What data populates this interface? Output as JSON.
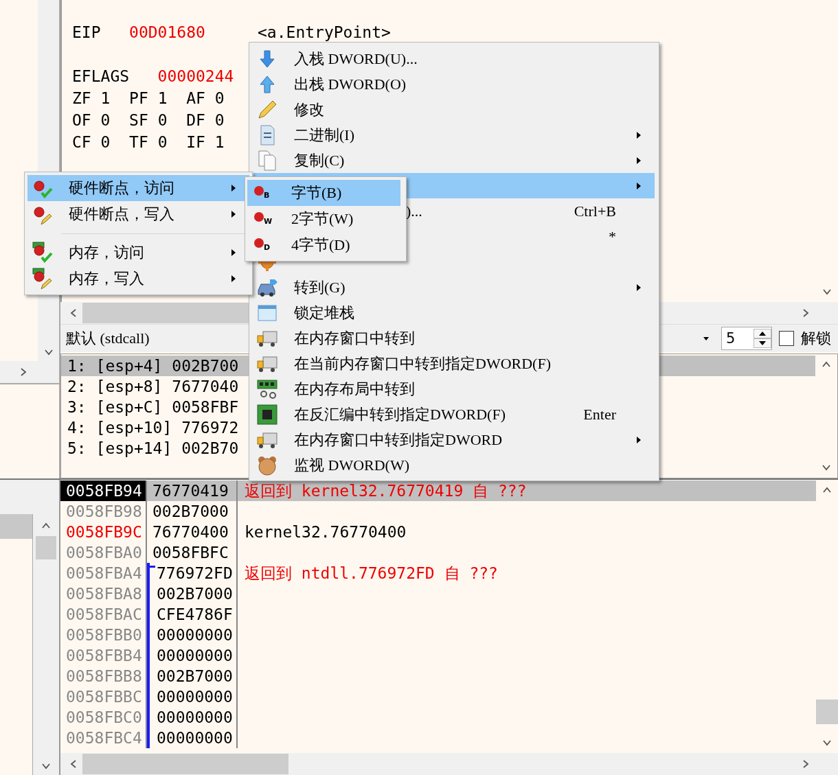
{
  "registers": {
    "eip": {
      "name": "EIP",
      "value": "00D01680",
      "changed": true,
      "comment": "<a.EntryPoint>"
    },
    "eflags": {
      "name": "EFLAGS",
      "value": "00000244",
      "changed": true
    },
    "flags": [
      [
        {
          "name": "ZF",
          "value": "1"
        },
        {
          "name": "PF",
          "value": "1"
        },
        {
          "name": "AF",
          "value": "0"
        }
      ],
      [
        {
          "name": "OF",
          "value": "0"
        },
        {
          "name": "SF",
          "value": "0"
        },
        {
          "name": "DF",
          "value": "0"
        }
      ],
      [
        {
          "name": "CF",
          "value": "0"
        },
        {
          "name": "TF",
          "value": "0"
        },
        {
          "name": "IF",
          "value": "1"
        }
      ]
    ]
  },
  "args_bar": {
    "convention": "默认 (stdcall)",
    "count": "5",
    "unlock": {
      "label": "解锁",
      "checked": false
    }
  },
  "args": [
    {
      "text": "1: [esp+4] 002B700",
      "selected": true
    },
    {
      "text": "2: [esp+8] 7677040",
      "selected": false
    },
    {
      "text": "3: [esp+C] 0058FBF",
      "selected": false
    },
    {
      "text": "4: [esp+10] 776972",
      "selected": false
    },
    {
      "text": "5: [esp+14] 002B70",
      "selected": false
    }
  ],
  "stack": [
    {
      "address": "0058FB94",
      "value": "76770419",
      "comment": "返回到 kernel32.76770419 自 ???",
      "return_address": true,
      "selected": true,
      "marked": false,
      "in_frame": false,
      "frame_start": false
    },
    {
      "address": "0058FB98",
      "value": "002B7000",
      "selected": false,
      "marked": false,
      "in_frame": false,
      "frame_start": false
    },
    {
      "address": "0058FB9C",
      "value": "76770400",
      "comment": "kernel32.76770400",
      "return_address": false,
      "selected": false,
      "marked": true,
      "in_frame": false,
      "frame_start": false
    },
    {
      "address": "0058FBA0",
      "value": "0058FBFC",
      "selected": false,
      "marked": false,
      "in_frame": false,
      "frame_start": false
    },
    {
      "address": "0058FBA4",
      "value": "776972FD",
      "comment": "返回到 ntdll.776972FD 自 ???",
      "return_address": true,
      "selected": false,
      "marked": false,
      "in_frame": true,
      "frame_start": true
    },
    {
      "address": "0058FBA8",
      "value": "002B7000",
      "selected": false,
      "marked": false,
      "in_frame": true,
      "frame_start": false
    },
    {
      "address": "0058FBAC",
      "value": "CFE4786F",
      "selected": false,
      "marked": false,
      "in_frame": true,
      "frame_start": false
    },
    {
      "address": "0058FBB0",
      "value": "00000000",
      "selected": false,
      "marked": false,
      "in_frame": true,
      "frame_start": false
    },
    {
      "address": "0058FBB4",
      "value": "00000000",
      "selected": false,
      "marked": false,
      "in_frame": true,
      "frame_start": false
    },
    {
      "address": "0058FBB8",
      "value": "002B7000",
      "selected": false,
      "marked": false,
      "in_frame": true,
      "frame_start": false
    },
    {
      "address": "0058FBBC",
      "value": "00000000",
      "selected": false,
      "marked": false,
      "in_frame": true,
      "frame_start": false
    },
    {
      "address": "0058FBC0",
      "value": "00000000",
      "selected": false,
      "marked": false,
      "in_frame": true,
      "frame_start": false
    },
    {
      "address": "0058FBC4",
      "value": "00000000",
      "selected": false,
      "marked": false,
      "in_frame": true,
      "frame_start": false
    }
  ],
  "context_menu": {
    "items": [
      {
        "kind": "item",
        "label": "入栈 DWORD(U)...",
        "submenu": false,
        "selected": false
      },
      {
        "kind": "item",
        "label": "出栈 DWORD(O)",
        "submenu": false,
        "selected": false
      },
      {
        "kind": "item",
        "label": "修改",
        "submenu": false,
        "selected": false
      },
      {
        "kind": "item",
        "label": "二进制(I)",
        "submenu": true,
        "selected": false
      },
      {
        "kind": "item",
        "label": "复制(C)",
        "submenu": true,
        "selected": false
      },
      {
        "kind": "covered",
        "submenu": true,
        "selected": true
      },
      {
        "kind": "covered",
        "label": ")...",
        "shortcut": "Ctrl+B",
        "submenu": false,
        "selected": false
      },
      {
        "kind": "covered",
        "shortcut": "*",
        "submenu": false,
        "selected": false
      },
      {
        "kind": "covered",
        "submenu": false,
        "selected": false
      },
      {
        "kind": "item",
        "label": "转到(G)",
        "submenu": true,
        "selected": false
      },
      {
        "kind": "item",
        "label": "锁定堆栈",
        "submenu": false,
        "selected": false
      },
      {
        "kind": "item",
        "label": "在内存窗口中转到",
        "submenu": false,
        "selected": false
      },
      {
        "kind": "item",
        "label": "在当前内存窗口中转到指定DWORD(F)",
        "submenu": false,
        "selected": false
      },
      {
        "kind": "item",
        "label": "在内存布局中转到",
        "submenu": false,
        "selected": false
      },
      {
        "kind": "item",
        "label": "在反汇编中转到指定DWORD(F)",
        "shortcut": "Enter",
        "submenu": false,
        "selected": false
      },
      {
        "kind": "item",
        "label": "在内存窗口中转到指定DWORD",
        "submenu": true,
        "selected": false
      },
      {
        "kind": "item",
        "label": "监视 DWORD(W)",
        "submenu": false,
        "selected": false
      }
    ]
  },
  "breakpoint_menu": {
    "items": [
      {
        "kind": "item",
        "label": "硬件断点，访问",
        "submenu": true,
        "selected": true
      },
      {
        "kind": "item",
        "label": "硬件断点，写入",
        "submenu": true,
        "selected": false
      },
      {
        "kind": "separator"
      },
      {
        "kind": "item",
        "label": "内存，访问",
        "submenu": true,
        "selected": false
      },
      {
        "kind": "item",
        "label": "内存，写入",
        "submenu": true,
        "selected": false
      }
    ]
  },
  "size_menu": {
    "items": [
      {
        "label": "字节(B)",
        "badge": "B",
        "selected": true
      },
      {
        "label": "2字节(W)",
        "badge": "W",
        "selected": false
      },
      {
        "label": "4字节(D)",
        "badge": "D",
        "selected": false
      }
    ]
  }
}
